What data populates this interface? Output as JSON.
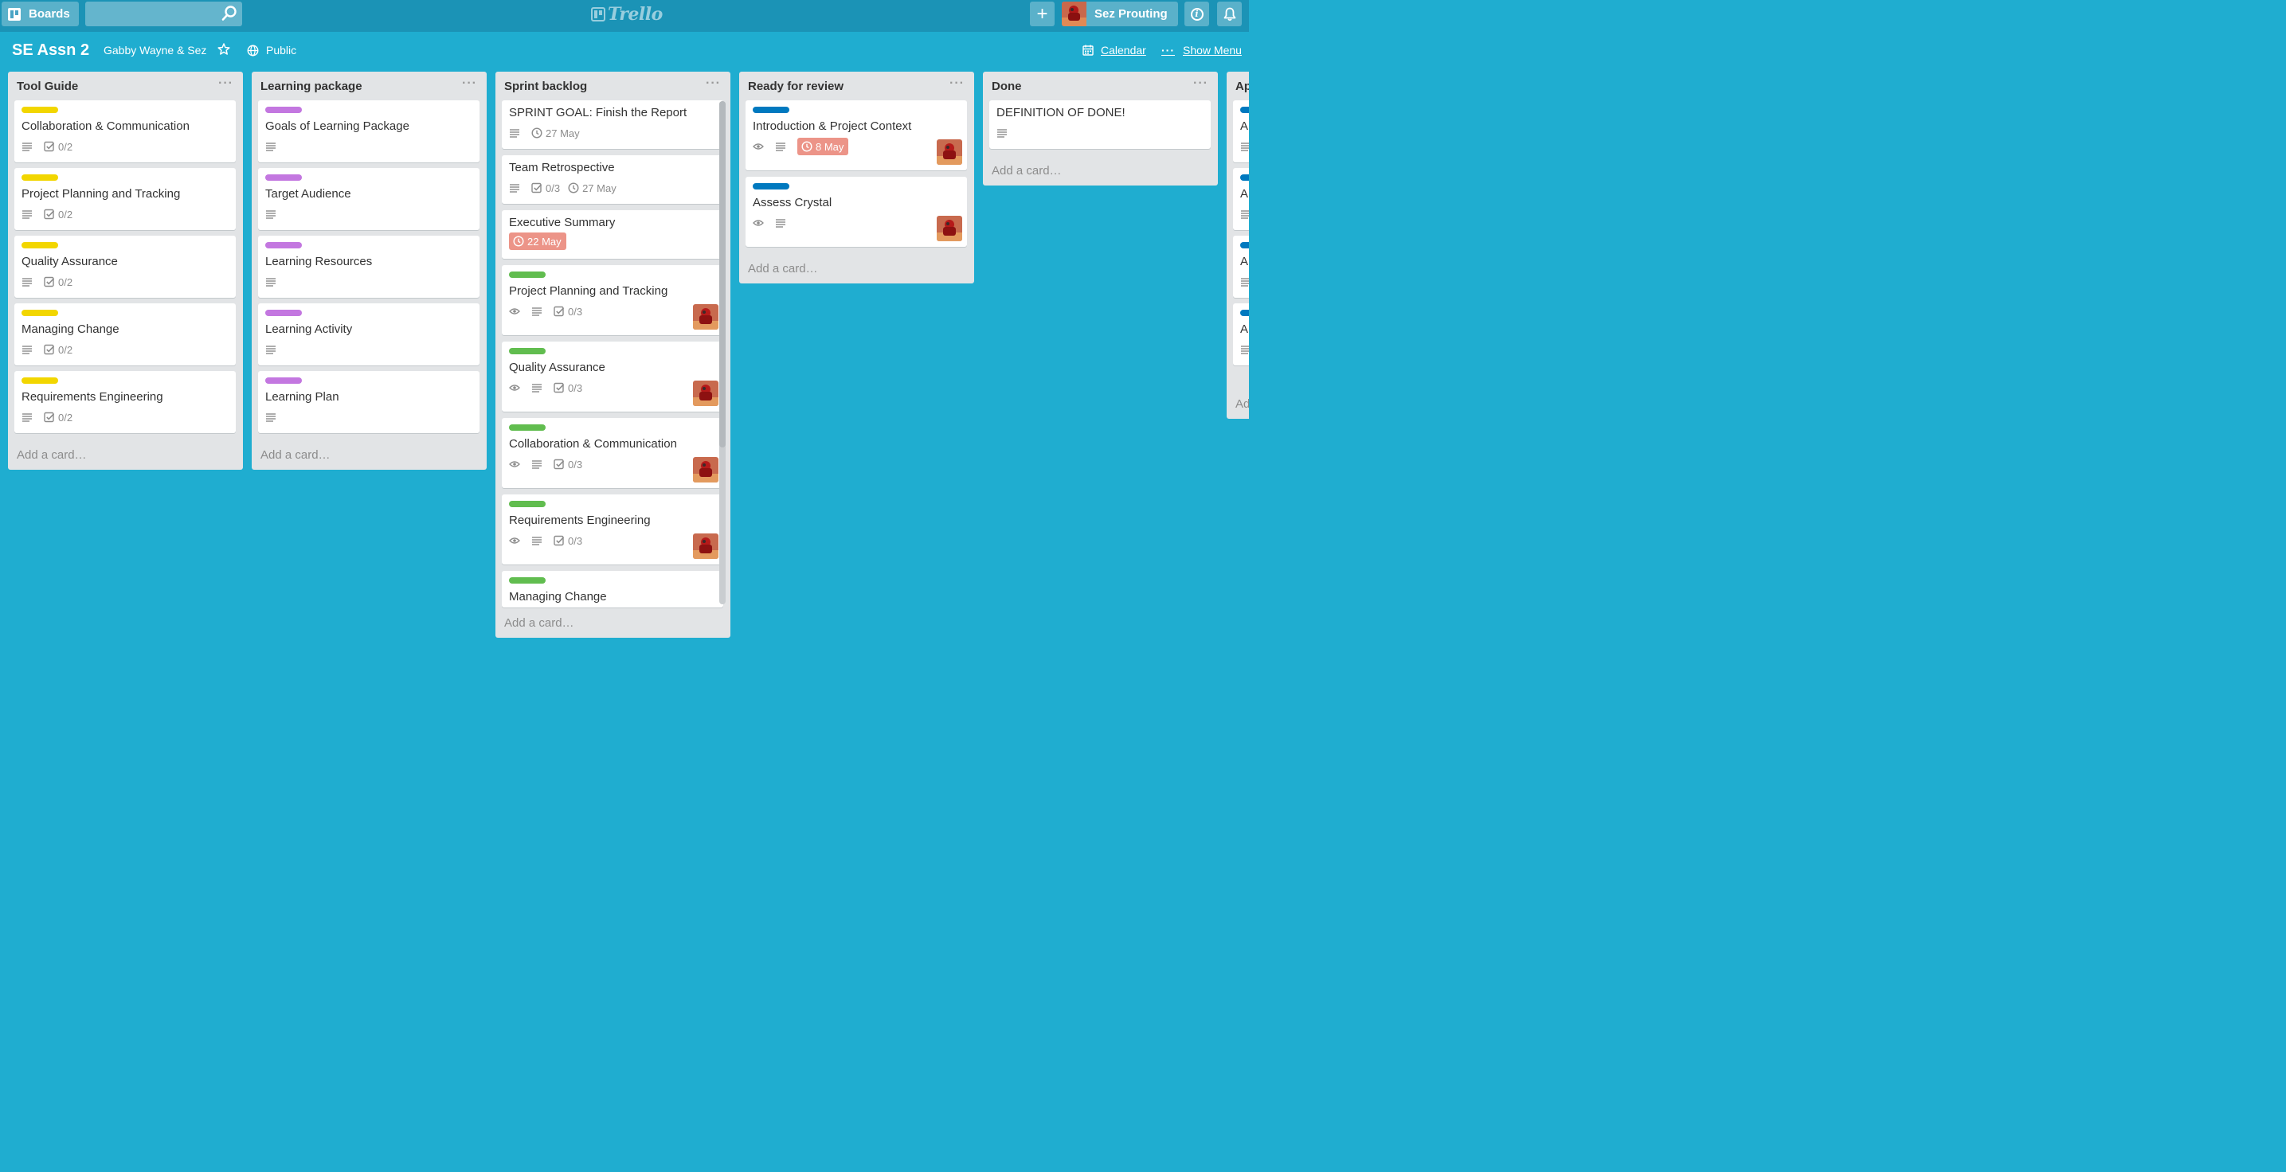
{
  "colors": {
    "board_bg": "#1fadd0",
    "topbar_bg": "#1b93b6",
    "list_bg": "#e2e4e6",
    "label_yellow": "#f2d600",
    "label_purple": "#c377e0",
    "label_green": "#61bd4f",
    "label_blue": "#0079bf",
    "due_overdue": "#ec9488"
  },
  "topbar": {
    "boards_label": "Boards",
    "search_placeholder": "",
    "logo_text": "Trello",
    "user_name": "Sez Prouting"
  },
  "board": {
    "title": "SE Assn 2",
    "team": "Gabby Wayne & Sez",
    "visibility": "Public",
    "calendar_label": "Calendar",
    "show_menu_label": "Show Menu",
    "menu_dots": "···"
  },
  "lists": [
    {
      "title": "Tool Guide",
      "cards": [
        {
          "title": "Collaboration & Communication",
          "label": "yellow",
          "checklist": "0/2"
        },
        {
          "title": "Project Planning and Tracking",
          "label": "yellow",
          "checklist": "0/2"
        },
        {
          "title": "Quality Assurance",
          "label": "yellow",
          "checklist": "0/2"
        },
        {
          "title": "Managing Change",
          "label": "yellow",
          "checklist": "0/2"
        },
        {
          "title": "Requirements Engineering",
          "label": "yellow",
          "checklist": "0/2"
        }
      ],
      "add_card": "Add a card…"
    },
    {
      "title": "Learning package",
      "cards": [
        {
          "title": "Goals of Learning Package",
          "label": "purple"
        },
        {
          "title": "Target Audience",
          "label": "purple"
        },
        {
          "title": "Learning Resources",
          "label": "purple"
        },
        {
          "title": "Learning Activity",
          "label": "purple"
        },
        {
          "title": "Learning Plan",
          "label": "purple"
        }
      ],
      "add_card": "Add a card…"
    },
    {
      "title": "Sprint backlog",
      "cards": [
        {
          "title": "SPRINT GOAL: Finish the Report",
          "due": "27 May"
        },
        {
          "title": "Team Retrospective",
          "checklist": "0/3",
          "due": "27 May"
        },
        {
          "title": "Executive Summary",
          "due": "22 May",
          "due_overdue": true
        },
        {
          "title": "Project Planning and Tracking",
          "label": "green",
          "checklist": "0/3",
          "watching": true,
          "member": true
        },
        {
          "title": "Quality Assurance",
          "label": "green",
          "checklist": "0/3",
          "watching": true,
          "member": true
        },
        {
          "title": "Collaboration & Communication",
          "label": "green",
          "checklist": "0/3",
          "watching": true,
          "member": true
        },
        {
          "title": "Requirements Engineering",
          "label": "green",
          "checklist": "0/3",
          "watching": true,
          "member": true
        },
        {
          "title": "Managing Change",
          "label": "green"
        }
      ],
      "add_card": "Add a card…"
    },
    {
      "title": "Ready for review",
      "cards": [
        {
          "title": "Introduction & Project Context",
          "label": "blue",
          "watching": true,
          "due": "8 May",
          "due_overdue": true,
          "member": true
        },
        {
          "title": "Assess Crystal",
          "label": "blue",
          "watching": true,
          "member": true
        }
      ],
      "add_card": "Add a card…"
    },
    {
      "title": "Done",
      "cards": [
        {
          "title": "DEFINITION OF DONE!"
        }
      ],
      "add_card": "Add a card…"
    },
    {
      "title": "Ap",
      "cards": [
        {
          "title": "A",
          "label": "blue"
        },
        {
          "title": "A",
          "label": "blue"
        },
        {
          "title": "A",
          "label": "blue"
        },
        {
          "title": "A",
          "label": "blue"
        }
      ],
      "add_card": "Ad"
    }
  ]
}
